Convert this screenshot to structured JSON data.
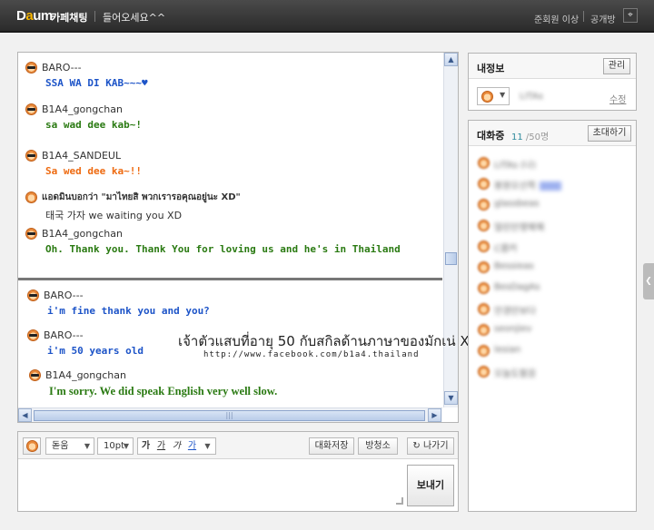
{
  "header": {
    "logo": "Daum",
    "app_name": "카페채팅",
    "room_title": "들어오세요^^",
    "level_filter": "준회원 이상",
    "visibility": "공개방",
    "pin_icon": "pin-icon"
  },
  "chat": {
    "messages_top": [
      {
        "nick": "BARO---",
        "text": "SSA WA DI KAB~~~♥",
        "color": "#1d54c8",
        "icon": "sunglasses-face-icon"
      },
      {
        "nick": "B1A4_gongchan",
        "text": "sa wad dee kab~!",
        "color": "#2a7a12",
        "icon": "sunglasses-face-icon"
      },
      {
        "nick": "B1A4_SANDEUL",
        "text": "Sa wed dee ka~!!",
        "color": "#ee6a10",
        "icon": "sunglasses-face-icon"
      },
      {
        "nick": "แอดมินบอกว่า \"มาไทยสิ พวกเรารอคุณอยู่นะ XD\"",
        "text": "태국 가자 we waiting you XD",
        "color": "#333333",
        "icon": "face-icon"
      },
      {
        "nick": "B1A4_gongchan",
        "text": "Oh. Thank you. Thank You for loving us and he's in Thailand",
        "color": "#2a7a12",
        "icon": "sunglasses-face-icon"
      }
    ],
    "messages_bottom": [
      {
        "nick": "BARO---",
        "text": "i'm fine thank you and you?",
        "color": "#1d54c8",
        "icon": "sunglasses-face-icon"
      },
      {
        "nick": "BARO---",
        "text": "i'm 50 years old",
        "color": "#1d54c8",
        "icon": "sunglasses-face-icon"
      },
      {
        "nick": "B1A4_gongchan",
        "text": "I'm sorry. We did speak English very well slow.",
        "color": "#2a7a12",
        "icon": "sunglasses-face-icon"
      }
    ],
    "overlay_caption": "เจ้าตัวแสบที่อายุ 50 กับสกิลด้านภาษาของมักเน่ XD",
    "overlay_url": "http://www.facebook.com/b1a4.thailand"
  },
  "composer": {
    "font_family": "돋움",
    "font_size": "10pt",
    "format_buttons": [
      "가",
      "가",
      "가",
      "가"
    ],
    "save_label": "대화저장",
    "broadcast_label": "방청소",
    "exit_label": "나가기",
    "send_label": "보내기"
  },
  "myinfo": {
    "title": "내정보",
    "manage_label": "관리",
    "nickname": "LITAs",
    "edit_label": "수정"
  },
  "participants": {
    "title": "대화중",
    "count": "11",
    "max": "/50명",
    "invite_label": "초대하기",
    "users": [
      "LITAs (나)",
      "봉원오산쪽",
      "glassbeas",
      "얼린만쟁웩웩",
      "C쾀커",
      "Bessieas",
      "BesDagAs",
      "안경만보다",
      "seonjiev",
      "lesian",
      "오늘도팔끔"
    ]
  },
  "colors": {
    "accent_blue": "#1d54c8",
    "accent_green": "#2a7a12",
    "accent_orange": "#ee6a10",
    "topbar": "#333333"
  }
}
